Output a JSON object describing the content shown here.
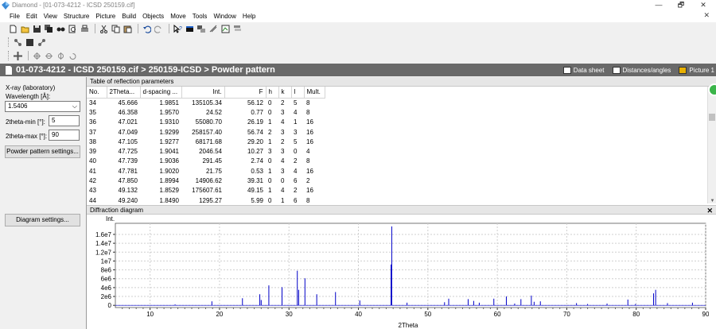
{
  "window": {
    "title": "Diamond - [01-073-4212 - ICSD 250159.cif]",
    "restore_glyph": "🗗",
    "close_glyph": "✕",
    "minimize_glyph": "—"
  },
  "menu": [
    "File",
    "Edit",
    "View",
    "Structure",
    "Picture",
    "Build",
    "Objects",
    "Move",
    "Tools",
    "Window",
    "Help"
  ],
  "toolbar1_icons": [
    "new-icon",
    "open-icon",
    "save-icon",
    "save-all-icon",
    "find-icon",
    "print-preview-icon",
    "print-icon",
    "cut-icon",
    "copy-icon",
    "paste-icon",
    "undo-icon",
    "redo-icon",
    "help-pointer-icon",
    "window1-icon",
    "window2-icon",
    "window3-icon",
    "window4-icon",
    "window5-icon"
  ],
  "pathbar": {
    "path": "01-073-4212 - ICSD 250159.cif > 250159-ICSD > Powder pattern",
    "tabs": [
      "Data sheet",
      "Distances/angles",
      "Picture 1"
    ]
  },
  "left": {
    "xray_label": "X-ray (laboratory)",
    "wavelength_label": "Wavelength [Å]:",
    "wavelength_value": "1.5406",
    "theta_min_label": "2theta-min [°]:",
    "theta_min_value": "5",
    "theta_max_label": "2theta-max [°]:",
    "theta_max_value": "90",
    "powder_btn": "Powder pattern settings...",
    "diagram_btn": "Diagram settings..."
  },
  "table": {
    "title": "Table of reflection parameters",
    "headers": [
      "No.",
      "2Theta...",
      "d-spacing ...",
      "Int.",
      "F",
      "h",
      "k",
      "l",
      "Mult."
    ],
    "rows": [
      [
        "34",
        "45.666",
        "1.9851",
        "135105.34",
        "56.12",
        "0",
        "2",
        "5",
        "8"
      ],
      [
        "35",
        "46.358",
        "1.9570",
        "24.52",
        "0.77",
        "0",
        "3",
        "4",
        "8"
      ],
      [
        "36",
        "47.021",
        "1.9310",
        "55080.70",
        "26.19",
        "1",
        "4",
        "1",
        "16"
      ],
      [
        "37",
        "47.049",
        "1.9299",
        "258157.40",
        "56.74",
        "2",
        "3",
        "3",
        "16"
      ],
      [
        "38",
        "47.105",
        "1.9277",
        "68171.68",
        "29.20",
        "1",
        "2",
        "5",
        "16"
      ],
      [
        "39",
        "47.725",
        "1.9041",
        "2046.54",
        "10.27",
        "3",
        "3",
        "0",
        "4"
      ],
      [
        "40",
        "47.739",
        "1.9036",
        "291.45",
        "2.74",
        "0",
        "4",
        "2",
        "8"
      ],
      [
        "41",
        "47.781",
        "1.9020",
        "21.75",
        "0.53",
        "1",
        "3",
        "4",
        "16"
      ],
      [
        "42",
        "47.850",
        "1.8994",
        "14906.62",
        "39.31",
        "0",
        "0",
        "6",
        "2"
      ],
      [
        "43",
        "49.132",
        "1.8529",
        "175607.61",
        "49.15",
        "1",
        "4",
        "2",
        "16"
      ],
      [
        "44",
        "49.240",
        "1.8490",
        "1295.27",
        "5.99",
        "0",
        "1",
        "6",
        "8"
      ]
    ]
  },
  "diagram": {
    "title": "Diffraction diagram"
  },
  "chart_data": {
    "type": "bar",
    "title": "",
    "xlabel": "2Theta",
    "ylabel": "Int.",
    "xlim": [
      5,
      90
    ],
    "ylim": [
      -500000,
      18500000
    ],
    "xticks": [
      10,
      20,
      30,
      40,
      50,
      60,
      70,
      80,
      90
    ],
    "ytick_values": [
      0,
      2000000,
      4000000,
      6000000,
      8000000,
      10000000,
      12000000,
      14000000,
      16000000
    ],
    "ytick_labels": [
      "0",
      "2e6",
      "4e6",
      "6e6",
      "8e6",
      "1e7",
      "1.2e7",
      "1.4e7",
      "1.6e7"
    ],
    "grid": true,
    "color": "#0000c8",
    "peaks": [
      [
        13.6,
        200000
      ],
      [
        18.9,
        900000
      ],
      [
        23.3,
        1600000
      ],
      [
        25.8,
        2500000
      ],
      [
        26.0,
        1200000
      ],
      [
        27.1,
        4500000
      ],
      [
        29.0,
        4100000
      ],
      [
        31.2,
        7800000
      ],
      [
        31.4,
        3500000
      ],
      [
        32.3,
        6100000
      ],
      [
        34.0,
        2500000
      ],
      [
        36.7,
        3000000
      ],
      [
        40.2,
        1100000
      ],
      [
        44.8,
        17800000
      ],
      [
        44.7,
        9200000
      ],
      [
        47.0,
        600000
      ],
      [
        52.4,
        700000
      ],
      [
        53.0,
        1500000
      ],
      [
        55.8,
        1400000
      ],
      [
        56.6,
        1000000
      ],
      [
        57.4,
        600000
      ],
      [
        59.5,
        1500000
      ],
      [
        61.3,
        2000000
      ],
      [
        62.5,
        400000
      ],
      [
        63.4,
        1400000
      ],
      [
        64.9,
        2200000
      ],
      [
        65.3,
        800000
      ],
      [
        66.2,
        900000
      ],
      [
        71.4,
        500000
      ],
      [
        73.0,
        300000
      ],
      [
        75.8,
        400000
      ],
      [
        78.8,
        1300000
      ],
      [
        79.9,
        300000
      ],
      [
        82.5,
        2700000
      ],
      [
        82.8,
        3500000
      ],
      [
        84.5,
        500000
      ],
      [
        88.1,
        600000
      ]
    ]
  }
}
